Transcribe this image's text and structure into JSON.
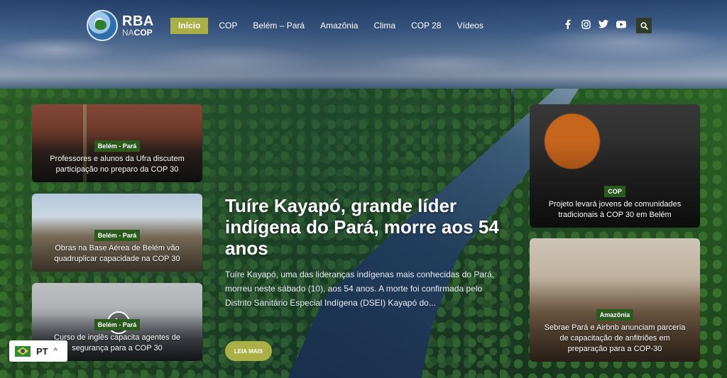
{
  "brand": {
    "name": "RBA",
    "sub_na": "NA",
    "sub_cop": "COP"
  },
  "nav": [
    {
      "label": "Início"
    },
    {
      "label": "COP"
    },
    {
      "label": "Belém – Pará"
    },
    {
      "label": "Amazônia"
    },
    {
      "label": "Clima"
    },
    {
      "label": "COP 28"
    },
    {
      "label": "Vídeos"
    }
  ],
  "social": [
    "facebook-icon",
    "instagram-icon",
    "twitter-icon",
    "youtube-icon"
  ],
  "search_icon": "search-icon",
  "feature": {
    "title": "Tuíre Kayapó, grande líder indígena do Pará, morre aos 54 anos",
    "excerpt": "Tuíre Kayapó, uma das lideranças indígenas mais conhecidas do Pará, morreu neste sábado (10), aos 54 anos. A morte foi confirmada pelo Distrito Sanitário Especial Indígena (DSEI) Kayapó do...",
    "read_more": "LEIA MAIS"
  },
  "cards_left": [
    {
      "tag": "Belém - Pará",
      "title": "Professores e alunos da Ufra discutem participação no preparo da COP 30"
    },
    {
      "tag": "Belém - Pará",
      "title": "Obras na Base Aérea de Belém vão quadruplicar capacidade na COP 30"
    },
    {
      "tag": "Belém - Pará",
      "title": "Curso de inglês capacita agentes de segurança para a COP 30"
    }
  ],
  "cards_right": [
    {
      "tag": "COP",
      "title": "Projeto levará jovens de comunidades tradicionais à COP 30 em Belém"
    },
    {
      "tag": "Amazônia",
      "title": "Sebrae Pará e Airbnb anunciam parceria de capacitação de anfitriões em preparação para a COP-30"
    }
  ],
  "language": {
    "code": "PT",
    "caret": "^"
  },
  "colors": {
    "accent": "#aab046",
    "tag": "#2b5a1f",
    "search_bg": "#2f3d2a"
  }
}
